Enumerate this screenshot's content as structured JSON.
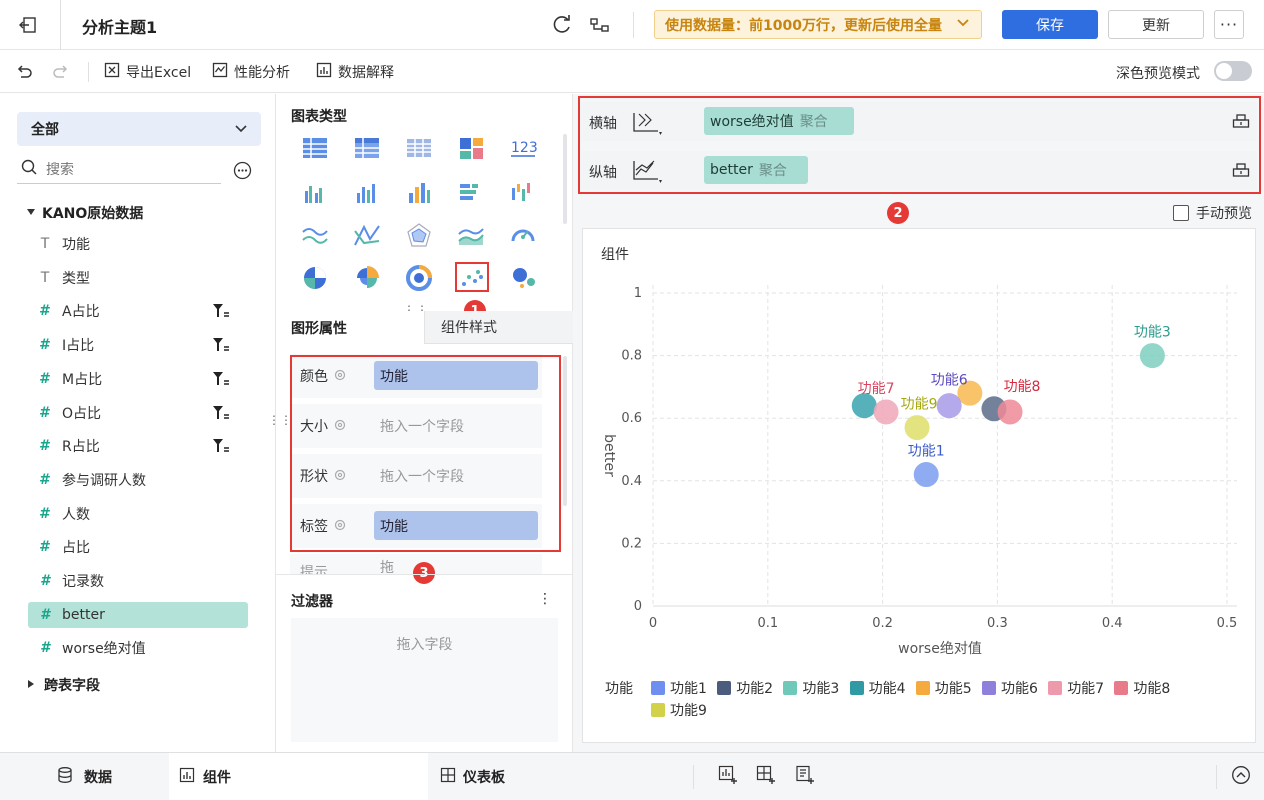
{
  "header": {
    "title": "分析主题1",
    "notice": "使用数据量：前1000万行，更新后使用全量",
    "save_label": "保存",
    "update_label": "更新"
  },
  "toolbar": {
    "export_label": "导出Excel",
    "perf_label": "性能分析",
    "explain_label": "数据解释",
    "dark_preview_label": "深色预览模式"
  },
  "left": {
    "scope": "全部",
    "search_placeholder": "搜索",
    "group_title": "KANO原始数据",
    "fields": [
      {
        "name": "功能",
        "type": "dim"
      },
      {
        "name": "类型",
        "type": "dim"
      },
      {
        "name": "A占比",
        "type": "num"
      },
      {
        "name": "I占比",
        "type": "num"
      },
      {
        "name": "M占比",
        "type": "num"
      },
      {
        "name": "O占比",
        "type": "num"
      },
      {
        "name": "R占比",
        "type": "num"
      },
      {
        "name": "参与调研人数",
        "type": "num"
      },
      {
        "name": "人数",
        "type": "num"
      },
      {
        "name": "占比",
        "type": "num"
      },
      {
        "name": "记录数",
        "type": "calc"
      },
      {
        "name": "better",
        "type": "calc"
      },
      {
        "name": "worse绝对值",
        "type": "calc"
      }
    ],
    "cross_fields": "跨表字段"
  },
  "middle": {
    "chart_type_title": "图表类型",
    "tab_props": "图形属性",
    "tab_style": "组件样式",
    "props": {
      "color_label": "颜色",
      "color_value": "功能",
      "size_label": "大小",
      "size_placeholder": "拖入一个字段",
      "shape_label": "形状",
      "shape_placeholder": "拖入一个字段",
      "label_label": "标签",
      "label_value": "功能",
      "tip_label": "提示",
      "tip_placeholder": "拖"
    },
    "filter_title": "过滤器",
    "filter_placeholder": "拖入字段"
  },
  "axes": {
    "x_label": "横轴",
    "x_field": "worse绝对值",
    "x_agg": "聚合",
    "y_label": "纵轴",
    "y_field": "better",
    "y_agg": "聚合"
  },
  "manual_preview": "手动预览",
  "badges": [
    "1",
    "2",
    "3"
  ],
  "bottom": {
    "tab_data": "数据",
    "tab_component": "组件",
    "tab_dashboard": "仪表板"
  },
  "chart_data": {
    "type": "scatter",
    "title": "组件",
    "xlabel": "worse绝对值",
    "ylabel": "better",
    "xlim": [
      0,
      0.5
    ],
    "ylim": [
      0,
      1
    ],
    "xticks": [
      "0",
      "0.1",
      "0.2",
      "0.3",
      "0.4",
      "0.5"
    ],
    "yticks": [
      "0",
      "0.2",
      "0.4",
      "0.6",
      "0.8",
      "1"
    ],
    "legend_title": "功能",
    "points": [
      {
        "name": "功能1",
        "x": 0.238,
        "y": 0.42,
        "color": "#7b9cf0",
        "label_color": "#3b5bc8"
      },
      {
        "name": "功能2",
        "x": 0.297,
        "y": 0.63,
        "color": "#5b6c88",
        "label_color": ""
      },
      {
        "name": "功能3",
        "x": 0.435,
        "y": 0.8,
        "color": "#7ecfc0",
        "label_color": "#2a9b8b"
      },
      {
        "name": "功能4",
        "x": 0.184,
        "y": 0.64,
        "color": "#3aa3ae",
        "label_color": ""
      },
      {
        "name": "功能5",
        "x": 0.276,
        "y": 0.68,
        "color": "#f7b84f",
        "label_color": ""
      },
      {
        "name": "功能6",
        "x": 0.258,
        "y": 0.64,
        "color": "#a79ae6",
        "label_color": "#5a48c0"
      },
      {
        "name": "功能7",
        "x": 0.203,
        "y": 0.62,
        "color": "#f0a7b8",
        "label_color": "#d8455f"
      },
      {
        "name": "功能8",
        "x": 0.311,
        "y": 0.62,
        "color": "#ef8a98",
        "label_color": "#d82a3e"
      },
      {
        "name": "功能9",
        "x": 0.23,
        "y": 0.57,
        "color": "#dede6a",
        "label_color": "#a5a80a"
      }
    ],
    "legend": [
      {
        "name": "功能1",
        "color": "#6e8ff0"
      },
      {
        "name": "功能2",
        "color": "#4c5c7c"
      },
      {
        "name": "功能3",
        "color": "#6ec9b8"
      },
      {
        "name": "功能4",
        "color": "#2f9aa4"
      },
      {
        "name": "功能5",
        "color": "#f4aa3c"
      },
      {
        "name": "功能6",
        "color": "#8f80dc"
      },
      {
        "name": "功能7",
        "color": "#ee9aad"
      },
      {
        "name": "功能8",
        "color": "#e97a8a"
      },
      {
        "name": "功能9",
        "color": "#d1d14a"
      }
    ]
  }
}
